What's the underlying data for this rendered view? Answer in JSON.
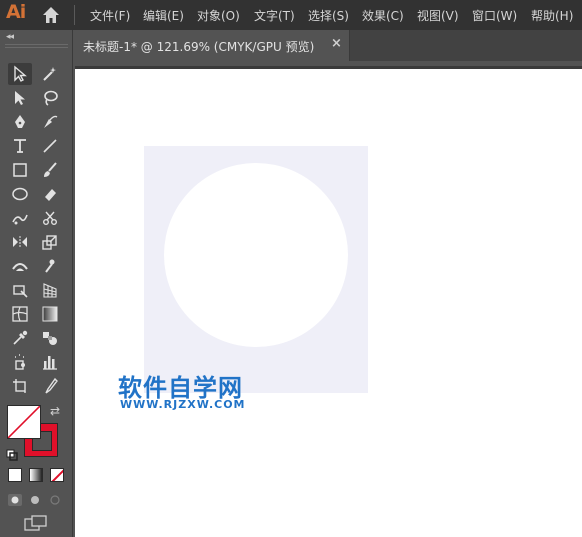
{
  "app": {
    "logo": "Ai"
  },
  "menu": [
    "文件(F)",
    "编辑(E)",
    "对象(O)",
    "文字(T)",
    "选择(S)",
    "效果(C)",
    "视图(V)",
    "窗口(W)",
    "帮助(H)"
  ],
  "document_tab": {
    "title": "未标题-1* @ 121.69% (CMYK/GPU 预览)",
    "close": "×"
  },
  "toolbar": {
    "collapse": "◂◂",
    "tools": [
      "selection-tool",
      "magic-wand-tool",
      "direct-selection-tool",
      "lasso-tool",
      "pen-tool",
      "curvature-tool",
      "type-tool",
      "line-segment-tool",
      "paintbrush-tool",
      "blob-brush-tool",
      "ellipse-tool",
      "eraser-tool",
      "shaper-tool",
      "scissors-tool",
      "reflect-tool",
      "scale-tool",
      "width-tool",
      "puppet-warp-tool",
      "free-transform-tool",
      "perspective-grid-tool",
      "mesh-tool",
      "gradient-tool",
      "eyedropper-tool",
      "blend-tool",
      "symbol-sprayer-tool",
      "column-graph-tool",
      "artboard-tool",
      "slice-tool",
      "hand-tool",
      "zoom-tool"
    ],
    "fill_color": "#ffffff",
    "stroke_color": "#e0102a"
  },
  "canvas": {
    "rect_color": "#efeff8",
    "circle_color": "#ffffff"
  },
  "watermark": {
    "cn": "软件自学网",
    "en": "WWW.RJZXW.COM"
  }
}
